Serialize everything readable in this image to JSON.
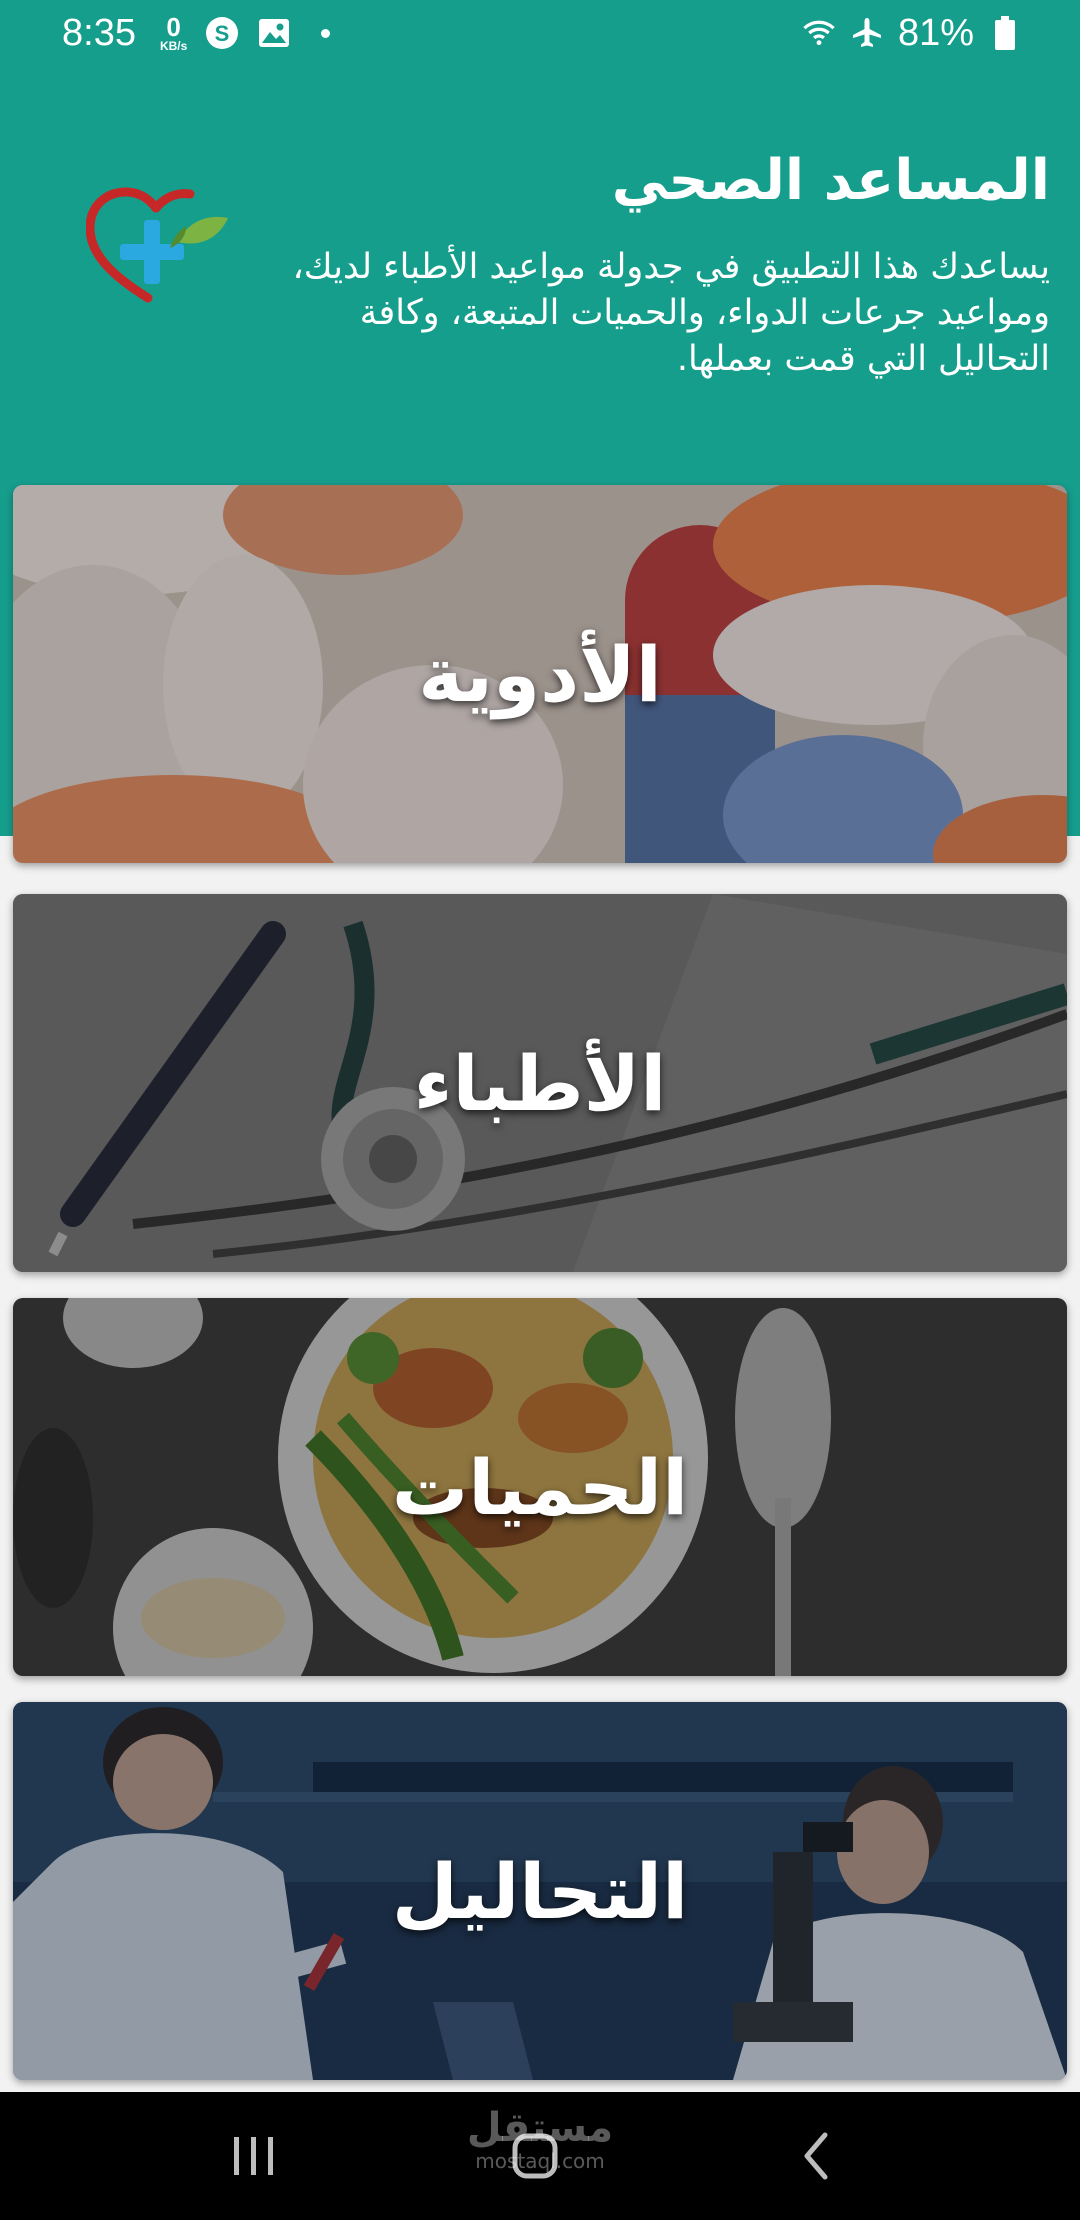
{
  "status_bar": {
    "time": "8:35",
    "net_speed_value": "0",
    "net_speed_unit": "KB/s",
    "battery": "81%",
    "icons": [
      "s-circle-icon",
      "gallery-icon",
      "wifi-icon",
      "airplane-icon",
      "battery-icon"
    ]
  },
  "header": {
    "title": "المساعد الصحي",
    "description": "يساعدك هذا التطبيق في جدولة مواعيد الأطباء لديك، ومواعيد جرعات الدواء، والحميات المتبعة، وكافة التحاليل التي قمت بعملها.",
    "logo": "heart-plus-logo",
    "background_color": "#169e8d"
  },
  "cards": [
    {
      "label": "الأدوية",
      "image": "pills-photo"
    },
    {
      "label": "الأطباء",
      "image": "stethoscope-photo"
    },
    {
      "label": "الحميات",
      "image": "healthy-food-photo"
    },
    {
      "label": "التحاليل",
      "image": "laboratory-photo"
    }
  ],
  "nav_bar": {
    "buttons": [
      "recent-apps",
      "home",
      "back"
    ],
    "watermark_arabic": "مستقل",
    "watermark_latin": "mostaql.com"
  }
}
